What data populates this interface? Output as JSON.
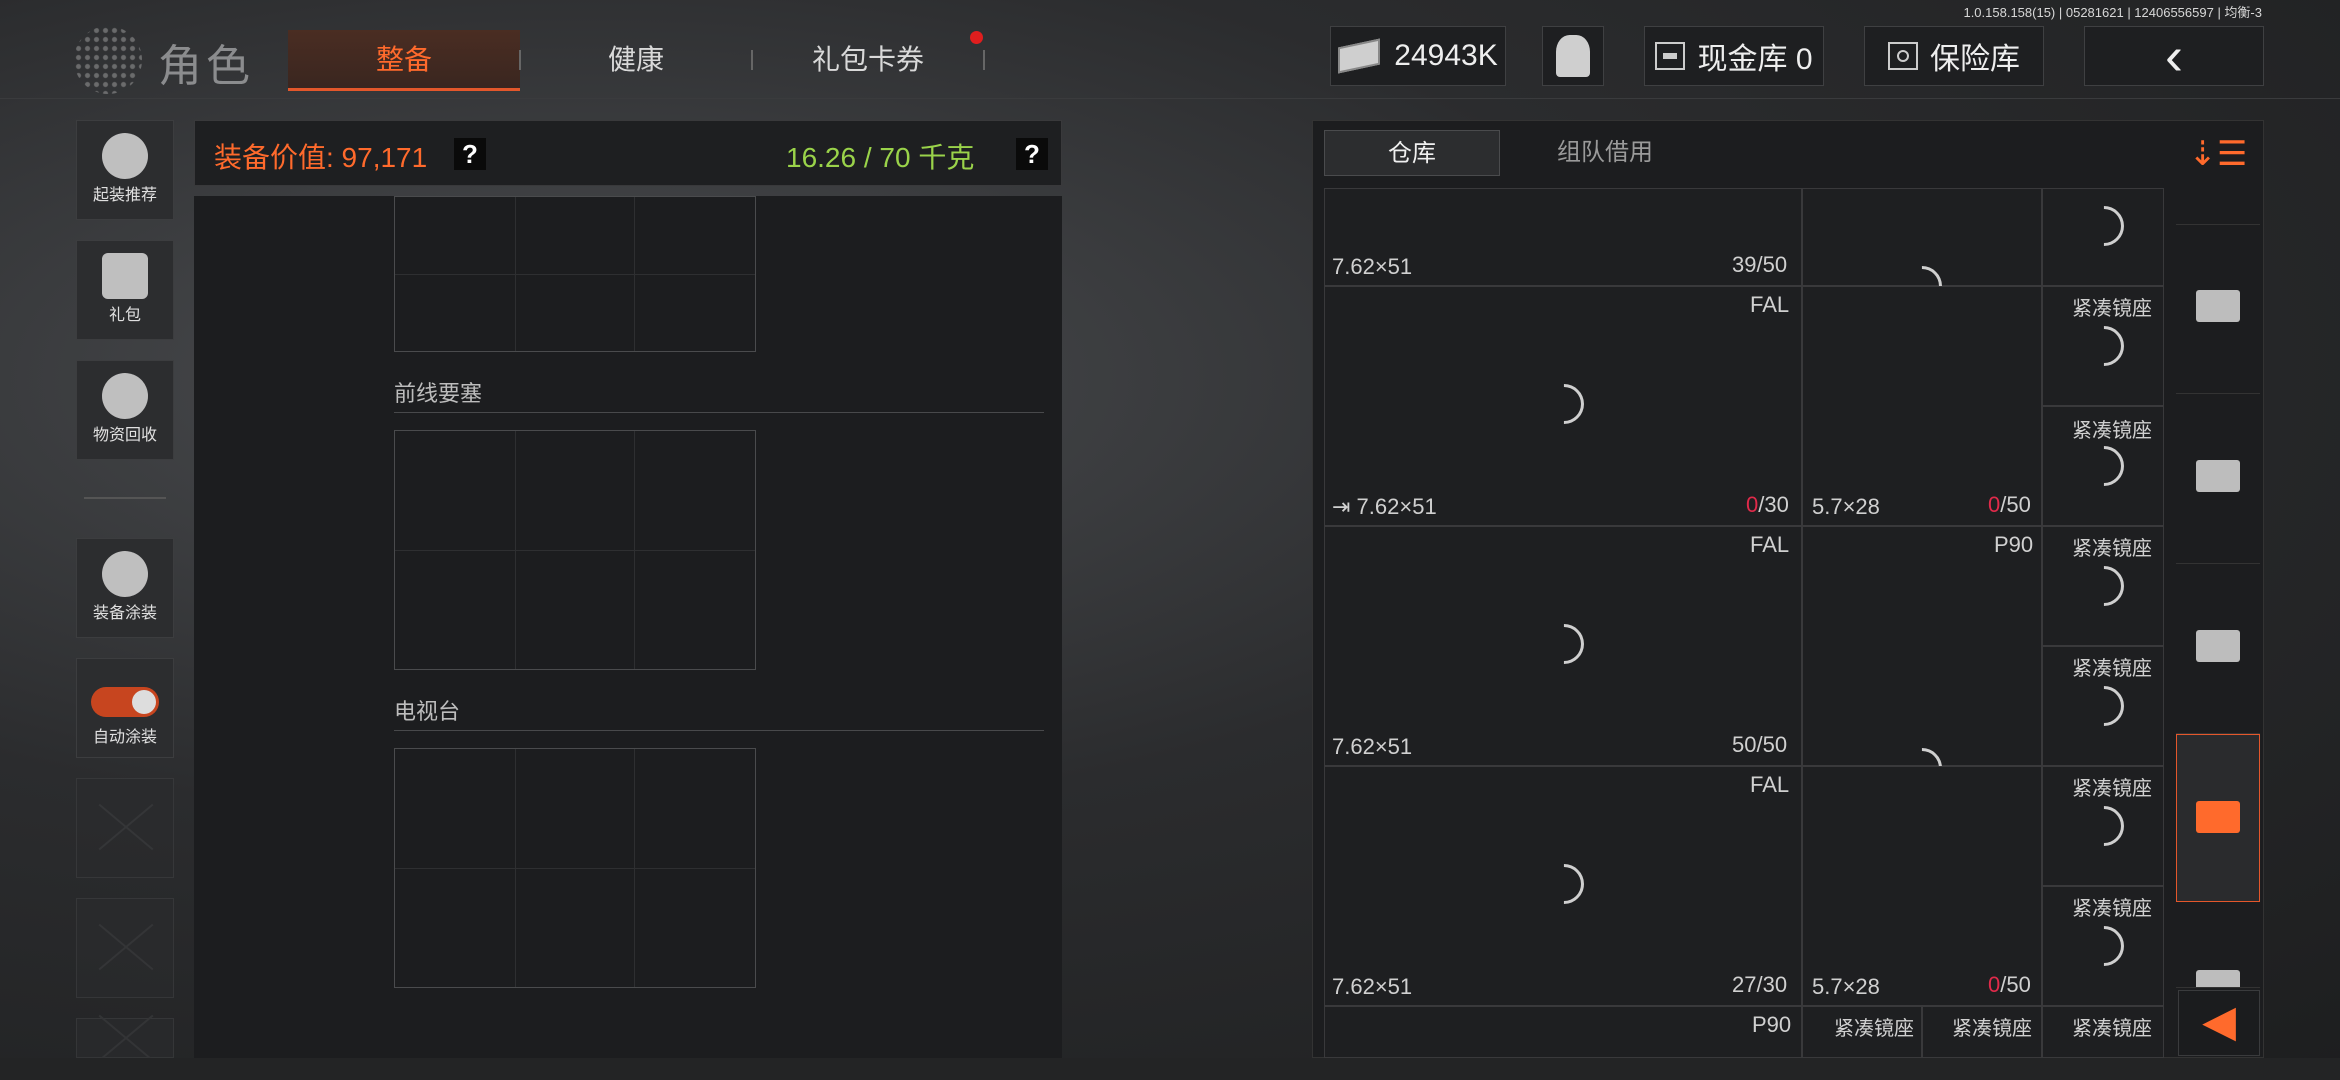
{
  "version": "1.0.158.158(15) | 05281621 | 12406556597 | 均衡-3",
  "header": {
    "title": "角色",
    "tabs": [
      {
        "label": "整备"
      },
      {
        "label": "健康"
      },
      {
        "label": "礼包卡券"
      }
    ],
    "money": "24943K",
    "gold": "现金库 0",
    "safe": "保险库"
  },
  "sidebar": {
    "items": [
      {
        "label": "起装推荐"
      },
      {
        "label": "礼包"
      },
      {
        "label": "物资回收"
      },
      {
        "label": "装备涂装"
      },
      {
        "label": "自动涂装"
      }
    ]
  },
  "equipment": {
    "value_text": "装备价值: 97,171",
    "weight_text": "16.26 / 70 千克",
    "help": "?",
    "sections": [
      {
        "title": "前线要塞"
      },
      {
        "title": "电视台"
      }
    ]
  },
  "warehouse": {
    "tabs": [
      {
        "label": "仓库"
      },
      {
        "label": "组队借用"
      }
    ],
    "rows": [
      {
        "left_name": "",
        "left_ammo": "7.62×51",
        "left_count_num": "39",
        "left_count_rest": "/50",
        "right_name": "",
        "right_ammo": "",
        "right_count_num": "",
        "right_count_rest": ""
      },
      {
        "left_name": "FAL",
        "left_ammo": "7.62×51",
        "left_count_num": "0",
        "left_count_rest": "/30",
        "right_name": "",
        "right_ammo": "5.7×28",
        "right_count_num": "0",
        "right_count_rest": "/50"
      },
      {
        "left_name": "FAL",
        "left_ammo": "7.62×51",
        "left_count_num": "50",
        "left_count_rest": "/50",
        "right_name": "P90",
        "right_ammo": "",
        "right_count_num": "",
        "right_count_rest": ""
      },
      {
        "left_name": "FAL",
        "left_ammo": "7.62×51",
        "left_count_num": "27",
        "left_count_rest": "/30",
        "right_name": "",
        "right_ammo": "5.7×28",
        "right_count_num": "0",
        "right_count_rest": "/50"
      }
    ],
    "mount_label": "紧凑镜座",
    "bottom_p90": "P90"
  }
}
